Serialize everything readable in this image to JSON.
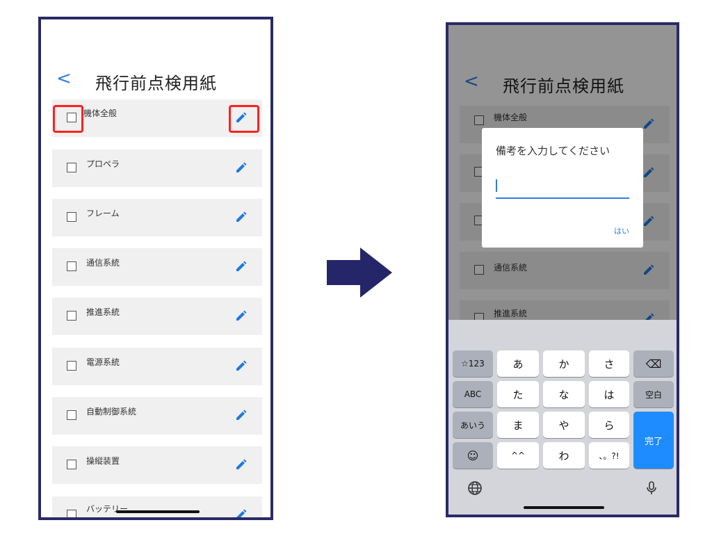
{
  "left_screen": {
    "title": "飛行前点検用紙",
    "back": "<",
    "items": [
      {
        "label": "機体全般"
      },
      {
        "label": "プロペラ"
      },
      {
        "label": "フレーム"
      },
      {
        "label": "通信系統"
      },
      {
        "label": "推進系統"
      },
      {
        "label": "電源系統"
      },
      {
        "label": "自動制御系統"
      },
      {
        "label": "操縦装置"
      },
      {
        "label": "バッテリー"
      }
    ]
  },
  "right_screen": {
    "title": "飛行前点検用紙",
    "back": "<",
    "items": [
      {
        "label": "機体全般"
      },
      {
        "label": "通信系統"
      },
      {
        "label": "推進系統"
      }
    ],
    "dialog": {
      "title": "備考を入力してください",
      "input_value": "",
      "ok_label": "はい"
    },
    "keyboard": {
      "keys": {
        "num": "☆123",
        "abc": "ABC",
        "hira": "あいう",
        "a": "あ",
        "ka": "か",
        "sa": "さ",
        "ta": "た",
        "na": "な",
        "ha": "は",
        "ma": "ま",
        "ya": "や",
        "ra": "ら",
        "dakuten": "^^",
        "wa": "わ",
        "punct": "、。?!",
        "space": "空白",
        "done": "完了",
        "emoji": "☺",
        "backspace": "⌫"
      }
    }
  },
  "colors": {
    "accent": "#2f7de1",
    "frame": "#2a2a66",
    "highlight": "#ff2020",
    "arrow": "#25256a",
    "done_key": "#1e8bff"
  }
}
